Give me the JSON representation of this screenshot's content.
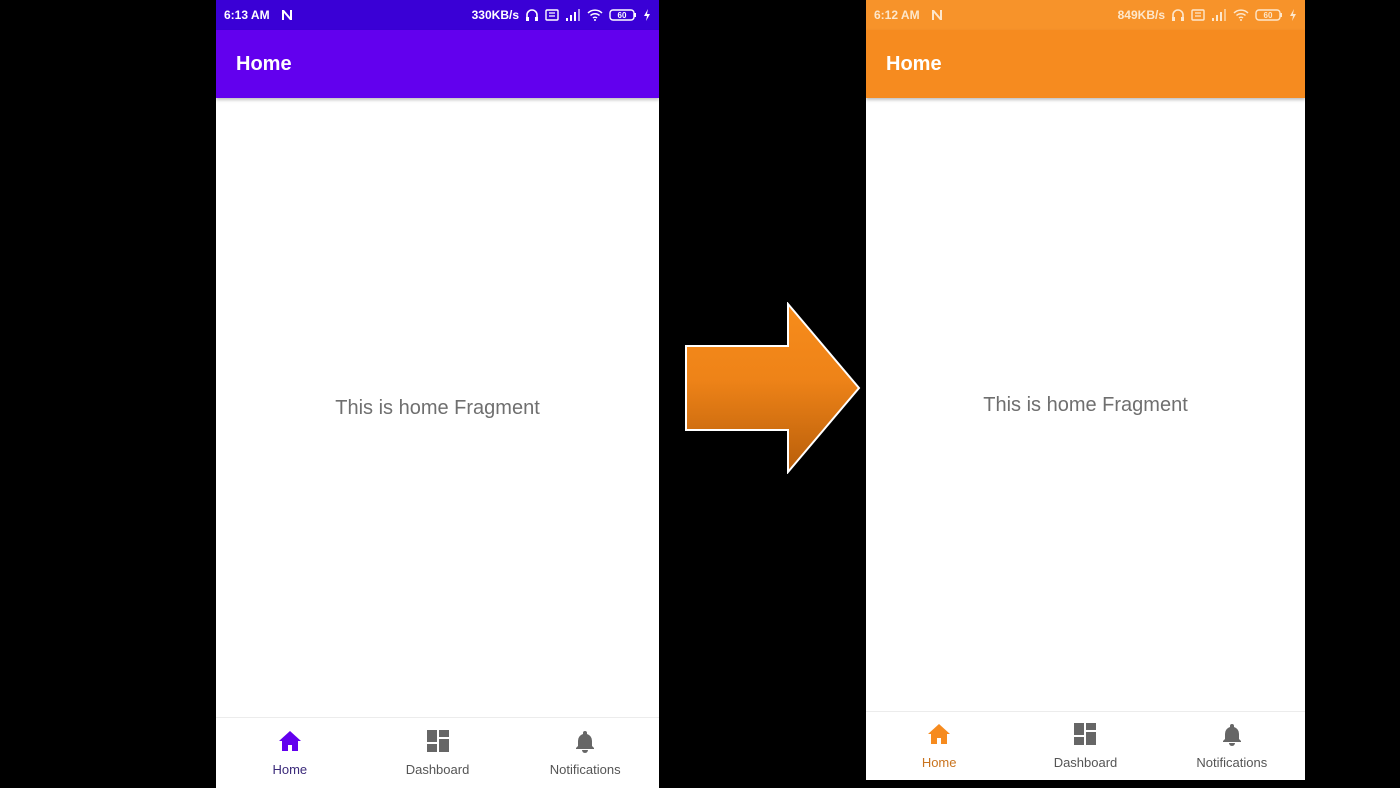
{
  "left_phone": {
    "status": {
      "time": "6:13 AM",
      "speed": "330KB/s",
      "battery": "60"
    },
    "appbar_title": "Home",
    "content_text": "This is home Fragment",
    "nav": [
      {
        "label": "Home",
        "icon": "home-icon",
        "active": true
      },
      {
        "label": "Dashboard",
        "icon": "dashboard-icon",
        "active": false
      },
      {
        "label": "Notifications",
        "icon": "bell-icon",
        "active": false
      }
    ],
    "colors": {
      "appbar": "#6200ee",
      "statusbar": "#3a00d6",
      "active_icon": "#6200ee"
    }
  },
  "right_phone": {
    "status": {
      "time": "6:12 AM",
      "speed": "849KB/s",
      "battery": "60"
    },
    "appbar_title": "Home",
    "content_text": "This is home Fragment",
    "nav": [
      {
        "label": "Home",
        "icon": "home-icon",
        "active": true
      },
      {
        "label": "Dashboard",
        "icon": "dashboard-icon",
        "active": false
      },
      {
        "label": "Notifications",
        "icon": "bell-icon",
        "active": false
      }
    ],
    "colors": {
      "appbar": "#f68b1f",
      "statusbar": "#f7932a",
      "active_icon": "#f68b1f"
    }
  },
  "arrow": {
    "icon": "arrow-right-icon",
    "color": "#f68b1f"
  }
}
